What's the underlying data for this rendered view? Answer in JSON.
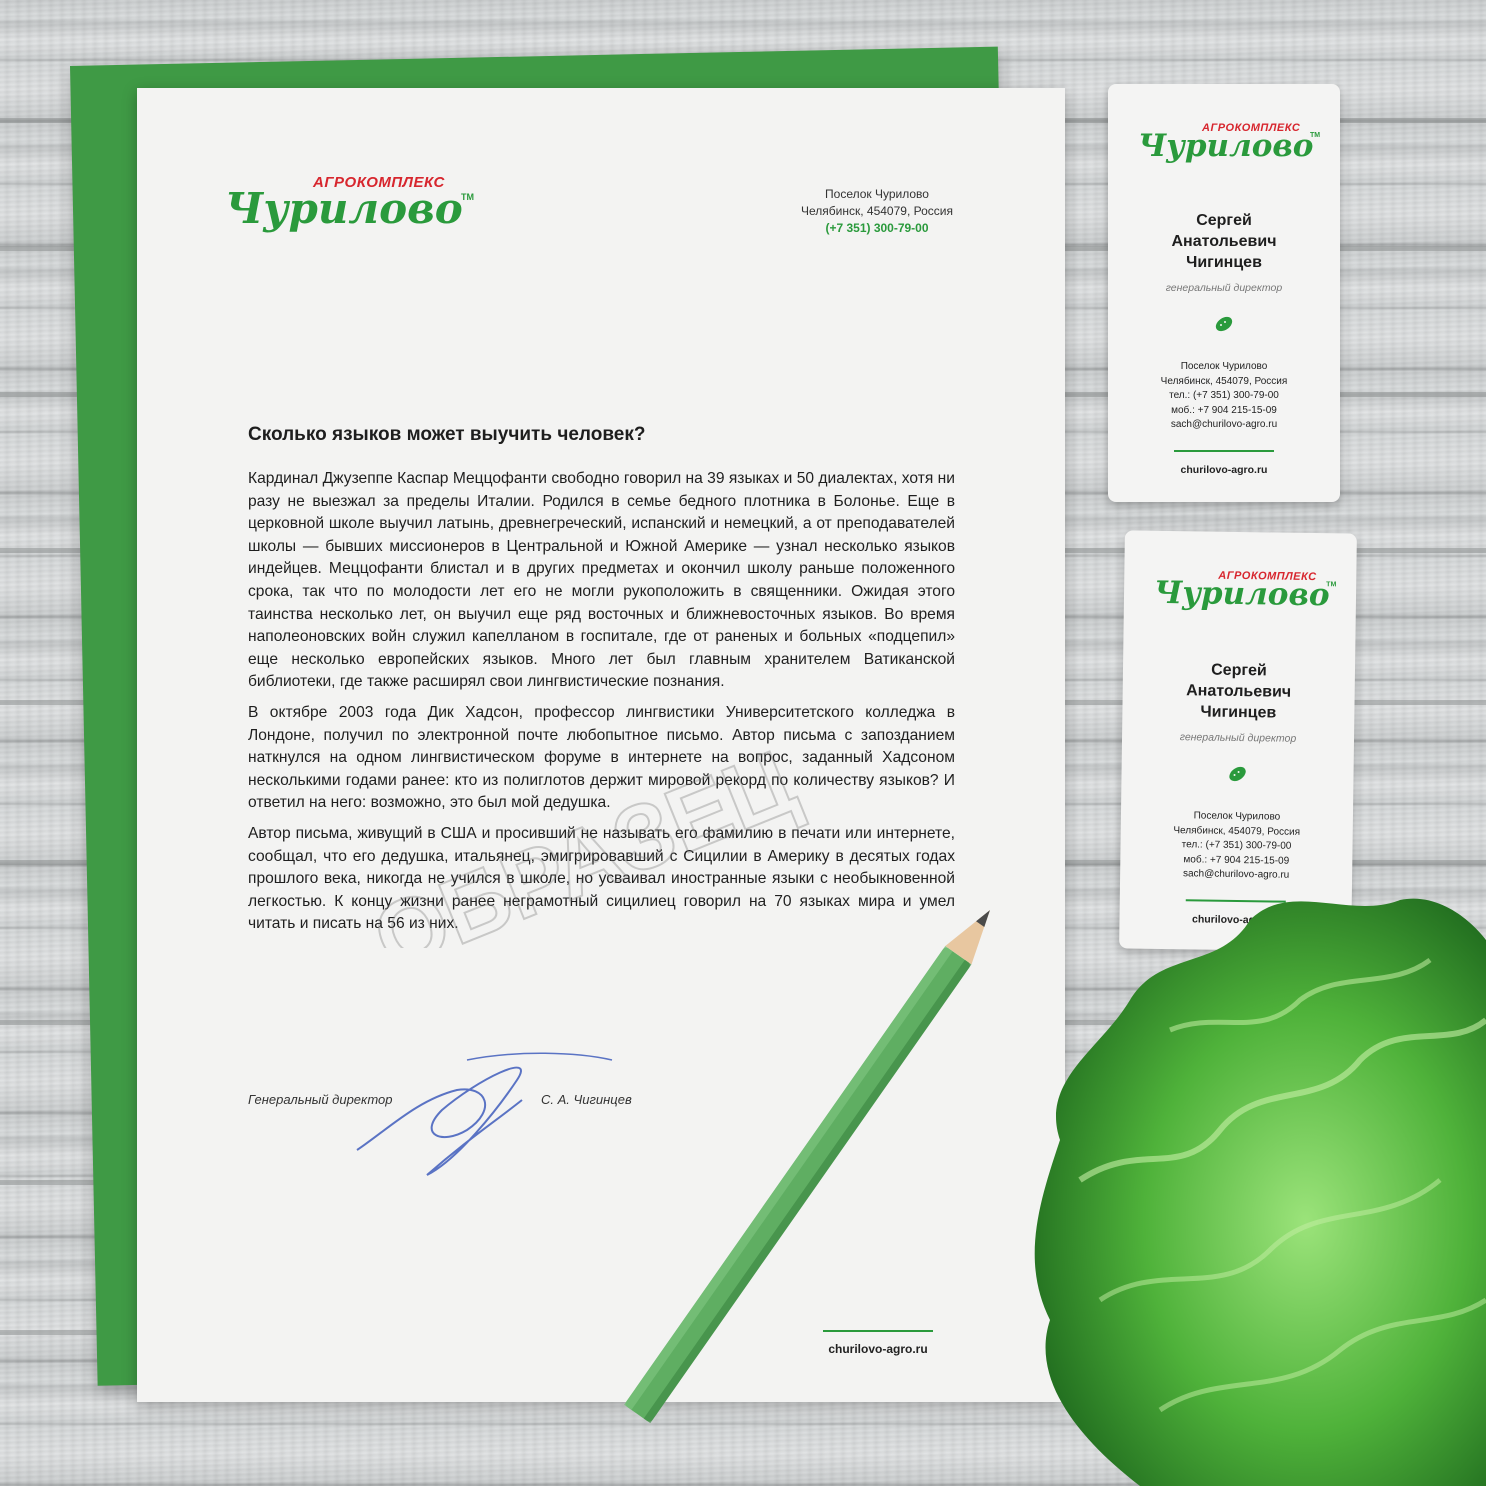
{
  "brand": {
    "subtitle": "АГРОКОМПЛЕКС",
    "name": "Чурилово",
    "tm": "TM"
  },
  "letterhead": {
    "address_line1": "Поселок Чурилово",
    "address_line2": "Челябинск, 454079, Россия",
    "phone": "(+7 351) 300-79-00"
  },
  "letter": {
    "title": "Сколько языков может выучить человек?",
    "paragraphs": [
      "Кардинал Джузеппе Каспар Меццофанти свободно говорил на 39 языках и 50 диалектах, хотя ни разу не выезжал за пределы Италии. Родился в семье бедного плотника в Болонье. Еще в церковной школе выучил латынь, древнегреческий, испанский и немецкий, а от преподавателей школы — бывших миссионеров в Центральной и Южной Америке — узнал несколько языков индейцев. Меццофанти блистал и в других предметах и окончил школу раньше положенного срока, так что по молодости лет его не могли рукоположить в священники. Ожидая этого таинства несколько лет, он выучил еще ряд восточных и ближневосточных языков. Во время наполеоновских войн служил капелланом в госпитале, где от раненых и больных «подцепил» еще несколько европейских языков. Много лет был главным хранителем Ватиканской библиотеки, где также расширял свои лингвистические познания.",
      "В октябре 2003 года Дик Хадсон, профессор лингвистики Университетского колледжа в Лондоне, получил по электронной почте любопытное письмо. Автор письма с запозданием наткнулся на одном лингвистическом форуме в интернете на вопрос, заданный Хадсоном несколькими годами ранее: кто из полиглотов держит мировой рекорд по количеству языков? И ответил на него: возможно, это был мой дедушка.",
      "Автор письма, живущий в США и просивший не называть его фамилию в печати или интернете, сообщал, что его дедушка, итальянец, эмигрировавший с Сицилии в Америку в десятых годах прошлого века, никогда не учился в школе, но усваивал иностранные языки с необыкновенной легкостью. К концу жизни ранее неграмотный сицилиец говорил на 70 языках мира и умел читать и писать на 56 из них."
    ],
    "signer_role": "Генеральный директор",
    "signer_name": "С. А. Чигинцев",
    "website": "churilovo-agro.ru"
  },
  "business_card": {
    "first_name": "Сергей",
    "patronymic": "Анатольевич",
    "last_name": "Чигинцев",
    "position": "генеральный директор",
    "address_line1": "Поселок Чурилово",
    "address_line2": "Челябинск, 454079, Россия",
    "phone": "тел.: (+7 351) 300-79-00",
    "mobile": "моб.: +7 904 215-15-09",
    "email": "sach@churilovo-agro.ru",
    "website": "churilovo-agro.ru"
  },
  "watermark": "ОБРАЗЕЦ",
  "colors": {
    "brand_green": "#2a9a3c",
    "brand_red": "#d7262e",
    "folder_green": "#3f9a45",
    "pencil_green": "#5fae62",
    "ink_blue": "#5a73c4"
  }
}
